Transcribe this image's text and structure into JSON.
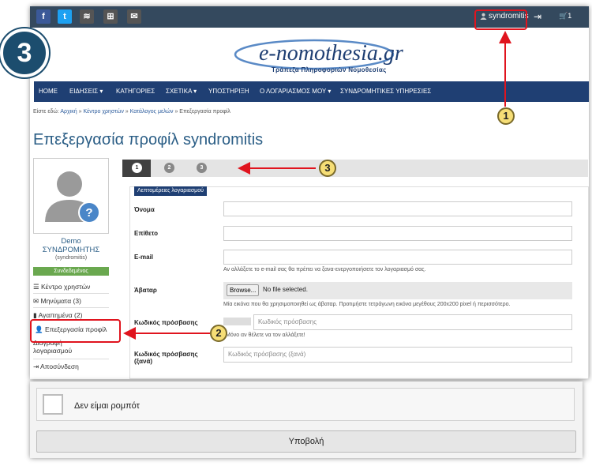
{
  "topbar": {
    "social": [
      {
        "icon": "facebook-icon",
        "glyph": "f",
        "color": "#3b5998"
      },
      {
        "icon": "twitter-icon",
        "glyph": "t",
        "color": "#1da1f2"
      },
      {
        "icon": "rss-icon",
        "glyph": "≋",
        "color": "#555555"
      },
      {
        "icon": "sitemap-icon",
        "glyph": "⊞",
        "color": "#555555"
      },
      {
        "icon": "email-icon",
        "glyph": "✉",
        "color": "#555555"
      }
    ],
    "username": "syndromitis",
    "cart_count": "1"
  },
  "header": {
    "logo_main": "e-nomothesia.gr",
    "logo_sub": "Τράπεζα Πληροφοριών Νομοθεσίας"
  },
  "nav": {
    "items": [
      "ΗΟΜΕ",
      "ΕΙΔΗΣΕΙΣ ▾",
      "ΚΑΤΗΓΟΡΙΕΣ",
      "ΣΧΕΤΙΚΑ ▾",
      "ΥΠΟΣΤΗΡΙΞΗ",
      "Ο ΛΟΓΑΡΙΑΣΜΟΣ ΜΟΥ ▾",
      "ΣΥΝΔΡΟΜΗΤΙΚΕΣ ΥΠΗΡΕΣΙΕΣ"
    ]
  },
  "breadcrumb": {
    "prefix": "Είστε εδώ:",
    "links": [
      "Αρχική",
      "Κέντρο χρηστών",
      "Κατάλογος μελών"
    ],
    "current": "Επεξεργασία προφίλ"
  },
  "page_title": "Επεξεργασία προφίλ syndromitis",
  "sidebar": {
    "name_line1": "Demo",
    "name_line2": "ΣΥΝΔΡΟΜΗΤΗΣ",
    "username": "(syndromitis)",
    "status": "Συνδεδεμένος",
    "items": [
      "Κέντρο χρηστών",
      "Μηνύματα (3)",
      "Αγαπημένα (2)",
      "Επεξεργασία προφίλ",
      "Διαγραφή",
      "λογαριασμού",
      "Αποσύνδεση"
    ]
  },
  "steps": [
    "1",
    "2",
    "3"
  ],
  "form": {
    "legend": "Λεπτομέρειες λογαριασμού",
    "first_name_label": "Όνομα",
    "last_name_label": "Επίθετο",
    "email_label": "E-mail",
    "email_help": "Αν αλλάξετε το e-mail σας θα πρέπει να ξανα-ενεργοποιήσετε τον λογαριασμό σας.",
    "avatar_label": "Άβαταρ",
    "browse_label": "Browse...",
    "file_status": "No file selected.",
    "avatar_help": "Μία εικόνα που θα χρησιμοποιηθεί ως άβαταρ. Προτιμήστε τετράγωνη εικόνα μεγέθους 200x200 pixel ή περισσότερο.",
    "password_label": "Κωδικός πρόσβασης",
    "password_placeholder": "Κωδικός πρόσβασης",
    "password_help": "Μόνο αν θέλετε να τον αλλάξετε!",
    "password2_label_1": "Κωδικός πρόσβασης",
    "password2_label_2": "(ξανά)",
    "password2_placeholder": "Κωδικός πρόσβασης (ξανά)"
  },
  "annotations": {
    "big_number": "3",
    "callouts": [
      "1",
      "2",
      "3"
    ]
  },
  "captcha": {
    "label": "Δεν είμαι ρομπότ"
  },
  "submit_label": "Υποβολή"
}
